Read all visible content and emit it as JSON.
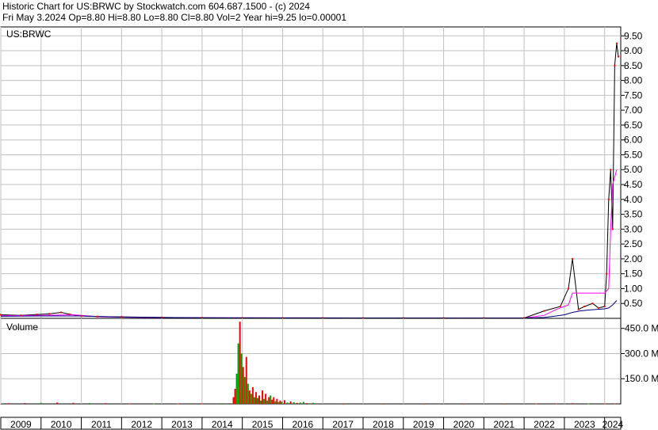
{
  "header": {
    "line1": "Historic Chart for US:BRWC by Stockwatch.com 604.687.1500 - (c) 2024",
    "line2": "Fri May  3.2024   Op=8.80   Hi=8.80   Lo=8.80   Cl=8.80   Vol=2   Year hi=9.25   lo=0.00001"
  },
  "colors": {
    "up": "#00a000",
    "down": "#ff0000",
    "price_line": "#000000",
    "ma_long": "#000080",
    "ma_short": "#ff00ff",
    "grid": "#c0c0c0"
  },
  "chart_data": [
    {
      "type": "line",
      "panel": "price",
      "title": "US:BRWC",
      "y_ticks": [
        "0.50",
        "1.00",
        "1.50",
        "2.00",
        "2.50",
        "3.00",
        "3.50",
        "4.00",
        "4.50",
        "5.00",
        "5.50",
        "6.00",
        "6.50",
        "7.00",
        "7.50",
        "8.00",
        "8.50",
        "9.00",
        "9.50"
      ],
      "ylim": [
        0,
        9.8
      ],
      "x_years": [
        "2009",
        "2010",
        "2011",
        "2012",
        "2013",
        "2014",
        "2015",
        "2016",
        "2017",
        "2018",
        "2019",
        "2020",
        "2021",
        "2022",
        "2023",
        "2024"
      ],
      "xlim": [
        2009.0,
        2024.4
      ],
      "series": [
        {
          "role": "price",
          "x": [
            2009.0,
            2009.5,
            2009.9,
            2010.2,
            2010.5,
            2010.7,
            2011.0,
            2011.4,
            2012.0,
            2013.0,
            2014.0,
            2015.0,
            2016.0,
            2017.0,
            2018.0,
            2019.0,
            2020.0,
            2021.0,
            2022.0,
            2022.5,
            2022.9,
            2023.1,
            2023.2,
            2023.35,
            2023.5,
            2023.7,
            2023.85,
            2024.0,
            2024.05,
            2024.1,
            2024.15,
            2024.2,
            2024.25,
            2024.3,
            2024.34
          ],
          "y": [
            0.12,
            0.1,
            0.13,
            0.15,
            0.2,
            0.14,
            0.08,
            0.06,
            0.05,
            0.03,
            0.02,
            0.01,
            0.01,
            0.01,
            0.01,
            0.01,
            0.01,
            0.01,
            0.01,
            0.25,
            0.4,
            1.0,
            2.0,
            0.3,
            0.4,
            0.5,
            0.35,
            0.4,
            1.5,
            4.0,
            5.0,
            3.0,
            8.5,
            9.25,
            8.8
          ]
        },
        {
          "role": "ma_short",
          "x": [
            2009.0,
            2010.0,
            2010.8,
            2011.5,
            2012.5,
            2014.0,
            2016.0,
            2018.0,
            2020.0,
            2021.0,
            2022.0,
            2022.5,
            2022.8,
            2023.0,
            2023.1,
            2023.2,
            2023.4,
            2023.6,
            2023.8,
            2024.0,
            2024.1,
            2024.15,
            2024.2,
            2024.3
          ],
          "y": [
            0.09,
            0.1,
            0.12,
            0.05,
            0.03,
            0.02,
            0.015,
            0.012,
            0.01,
            0.01,
            0.01,
            0.1,
            0.3,
            0.4,
            0.45,
            0.85,
            0.85,
            0.85,
            0.85,
            0.85,
            1.0,
            3.0,
            4.5,
            5.0
          ]
        },
        {
          "role": "ma_long",
          "x": [
            2009.0,
            2010.0,
            2011.0,
            2012.0,
            2014.0,
            2016.0,
            2018.0,
            2020.0,
            2022.0,
            2022.5,
            2022.8,
            2023.0,
            2023.2,
            2023.4,
            2023.6,
            2023.8,
            2024.0,
            2024.1,
            2024.2,
            2024.3
          ],
          "y": [
            0.07,
            0.08,
            0.08,
            0.04,
            0.02,
            0.015,
            0.012,
            0.01,
            0.01,
            0.03,
            0.08,
            0.12,
            0.2,
            0.25,
            0.28,
            0.3,
            0.32,
            0.35,
            0.45,
            0.6
          ]
        }
      ]
    },
    {
      "type": "bar",
      "panel": "volume",
      "title": "Volume",
      "y_ticks": [
        "150.0 M",
        "300.0 M",
        "450.0 M"
      ],
      "ylim": [
        0,
        510
      ],
      "x_years": [
        "2009",
        "2010",
        "2011",
        "2012",
        "2013",
        "2014",
        "2015",
        "2016",
        "2017",
        "2018",
        "2019",
        "2020",
        "2021",
        "2022",
        "2023",
        "2024"
      ],
      "xlim": [
        2009.0,
        2024.4
      ],
      "bars": [
        {
          "x": 2009.2,
          "v": 4,
          "c": "down"
        },
        {
          "x": 2009.6,
          "v": 5,
          "c": "down"
        },
        {
          "x": 2010.0,
          "v": 6,
          "c": "up"
        },
        {
          "x": 2010.4,
          "v": 8,
          "c": "down"
        },
        {
          "x": 2010.8,
          "v": 6,
          "c": "down"
        },
        {
          "x": 2011.2,
          "v": 5,
          "c": "up"
        },
        {
          "x": 2011.6,
          "v": 4,
          "c": "down"
        },
        {
          "x": 2012.2,
          "v": 3,
          "c": "down"
        },
        {
          "x": 2012.8,
          "v": 3,
          "c": "up"
        },
        {
          "x": 2013.4,
          "v": 2,
          "c": "down"
        },
        {
          "x": 2014.0,
          "v": 3,
          "c": "down"
        },
        {
          "x": 2014.5,
          "v": 4,
          "c": "up"
        },
        {
          "x": 2014.78,
          "v": 40,
          "c": "down"
        },
        {
          "x": 2014.82,
          "v": 90,
          "c": "down"
        },
        {
          "x": 2014.86,
          "v": 180,
          "c": "up"
        },
        {
          "x": 2014.9,
          "v": 360,
          "c": "up"
        },
        {
          "x": 2014.94,
          "v": 490,
          "c": "down"
        },
        {
          "x": 2014.98,
          "v": 300,
          "c": "up"
        },
        {
          "x": 2015.02,
          "v": 220,
          "c": "down"
        },
        {
          "x": 2015.06,
          "v": 160,
          "c": "up"
        },
        {
          "x": 2015.1,
          "v": 280,
          "c": "down"
        },
        {
          "x": 2015.14,
          "v": 120,
          "c": "up"
        },
        {
          "x": 2015.18,
          "v": 80,
          "c": "down"
        },
        {
          "x": 2015.22,
          "v": 60,
          "c": "up"
        },
        {
          "x": 2015.26,
          "v": 100,
          "c": "down"
        },
        {
          "x": 2015.3,
          "v": 40,
          "c": "up"
        },
        {
          "x": 2015.34,
          "v": 70,
          "c": "down"
        },
        {
          "x": 2015.38,
          "v": 35,
          "c": "up"
        },
        {
          "x": 2015.42,
          "v": 50,
          "c": "down"
        },
        {
          "x": 2015.46,
          "v": 20,
          "c": "up"
        },
        {
          "x": 2015.5,
          "v": 80,
          "c": "down"
        },
        {
          "x": 2015.54,
          "v": 30,
          "c": "up"
        },
        {
          "x": 2015.58,
          "v": 60,
          "c": "down"
        },
        {
          "x": 2015.62,
          "v": 20,
          "c": "up"
        },
        {
          "x": 2015.66,
          "v": 40,
          "c": "down"
        },
        {
          "x": 2015.7,
          "v": 50,
          "c": "up"
        },
        {
          "x": 2015.74,
          "v": 25,
          "c": "down"
        },
        {
          "x": 2015.78,
          "v": 40,
          "c": "down"
        },
        {
          "x": 2015.82,
          "v": 15,
          "c": "up"
        },
        {
          "x": 2015.86,
          "v": 30,
          "c": "down"
        },
        {
          "x": 2015.9,
          "v": 10,
          "c": "up"
        },
        {
          "x": 2015.94,
          "v": 20,
          "c": "down"
        },
        {
          "x": 2015.98,
          "v": 12,
          "c": "up"
        },
        {
          "x": 2016.05,
          "v": 22,
          "c": "down"
        },
        {
          "x": 2016.12,
          "v": 8,
          "c": "up"
        },
        {
          "x": 2016.2,
          "v": 15,
          "c": "down"
        },
        {
          "x": 2016.28,
          "v": 10,
          "c": "up"
        },
        {
          "x": 2016.36,
          "v": 6,
          "c": "down"
        },
        {
          "x": 2016.44,
          "v": 8,
          "c": "up"
        },
        {
          "x": 2016.52,
          "v": 12,
          "c": "up"
        },
        {
          "x": 2016.6,
          "v": 5,
          "c": "down"
        },
        {
          "x": 2016.68,
          "v": 4,
          "c": "up"
        },
        {
          "x": 2016.76,
          "v": 6,
          "c": "up"
        },
        {
          "x": 2017.5,
          "v": 1,
          "c": "down"
        },
        {
          "x": 2018.5,
          "v": 1,
          "c": "down"
        },
        {
          "x": 2019.5,
          "v": 1,
          "c": "down"
        },
        {
          "x": 2020.5,
          "v": 1,
          "c": "down"
        },
        {
          "x": 2021.5,
          "v": 1,
          "c": "down"
        },
        {
          "x": 2022.3,
          "v": 2,
          "c": "down"
        },
        {
          "x": 2022.8,
          "v": 3,
          "c": "down"
        },
        {
          "x": 2023.2,
          "v": 4,
          "c": "down"
        },
        {
          "x": 2023.6,
          "v": 3,
          "c": "up"
        },
        {
          "x": 2024.0,
          "v": 2,
          "c": "down"
        },
        {
          "x": 2024.25,
          "v": 3,
          "c": "down"
        }
      ]
    }
  ]
}
